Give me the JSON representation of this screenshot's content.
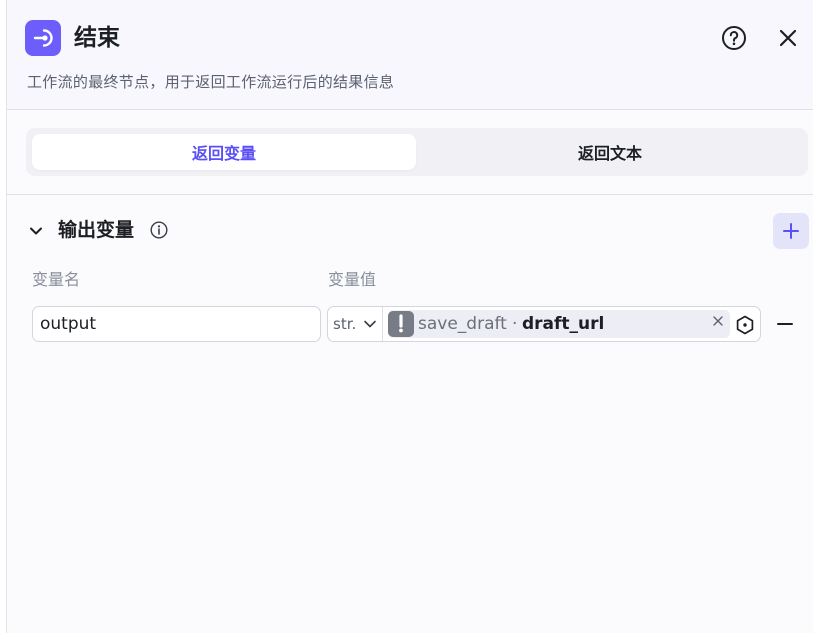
{
  "header": {
    "title": "结束",
    "description": "工作流的最终节点，用于返回工作流运行后的结果信息"
  },
  "tabs": [
    {
      "label": "返回变量",
      "active": true
    },
    {
      "label": "返回文本",
      "active": false
    }
  ],
  "section": {
    "title": "输出变量"
  },
  "columns": {
    "name_label": "变量名",
    "value_label": "变量值"
  },
  "rows": [
    {
      "name": "output",
      "type": "str.",
      "ref_node": "save_draft",
      "ref_separator": "·",
      "ref_field": "draft_url"
    }
  ],
  "colors": {
    "accent": "#5b4ff5",
    "node_icon_bg": "#6d5efc",
    "add_button_bg": "#e3e3fa",
    "warning_icon_bg": "#787c87"
  },
  "icons": {
    "node": "end-node-icon",
    "help": "question-circle-icon",
    "close": "close-icon",
    "collapse": "chevron-down-icon",
    "info": "info-icon",
    "add": "plus-icon",
    "warning": "exclamation-icon",
    "clear": "clear-x-icon",
    "picker": "variable-picker-icon",
    "remove": "minus-icon"
  }
}
